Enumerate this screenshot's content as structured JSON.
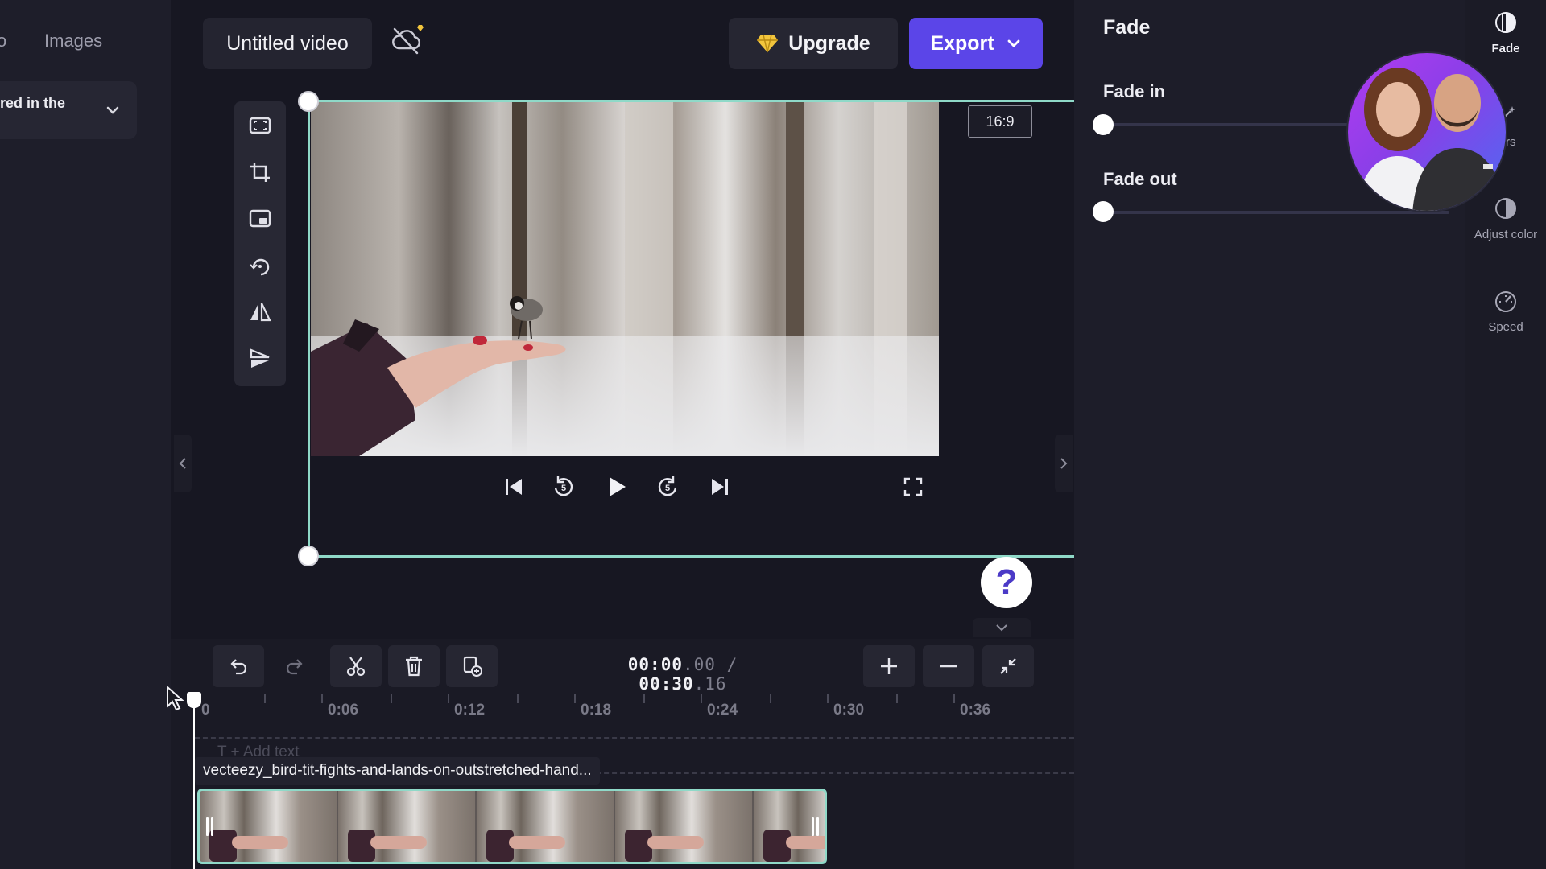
{
  "left_panel": {
    "tabs": [
      {
        "label": "o"
      },
      {
        "label": "Images"
      }
    ],
    "card_text": "red in the"
  },
  "header": {
    "project_title": "Untitled video",
    "upgrade_label": "Upgrade",
    "export_label": "Export"
  },
  "preview": {
    "aspect_ratio": "16:9"
  },
  "help_label": "?",
  "timeline": {
    "current_time": "00:00",
    "current_frac": ".00",
    "separator": "/",
    "total_time": "00:30",
    "total_frac": ".16",
    "ruler_labels": [
      "0",
      "0:06",
      "0:12",
      "0:18",
      "0:24",
      "0:30",
      "0:36"
    ],
    "add_text_placeholder": "T  + Add text",
    "clip_name": "vecteezy_bird-tit-fights-and-lands-on-outstretched-hand..."
  },
  "right_panel": {
    "title": "Fade",
    "fade_in_label": "Fade in",
    "fade_out_label": "Fade out",
    "fade_in_value": 0,
    "fade_out_value": 0
  },
  "right_rail": {
    "items": [
      {
        "label": "Fade",
        "icon": "fade-icon"
      },
      {
        "label": "ters",
        "icon": "filters-icon"
      },
      {
        "label": "Adjust color",
        "icon": "adjust-color-icon"
      },
      {
        "label": "Speed",
        "icon": "speed-icon"
      }
    ]
  },
  "colors": {
    "accent": "#5b45e8",
    "selection": "#8fd9c8",
    "premium": "#f2c53d"
  }
}
